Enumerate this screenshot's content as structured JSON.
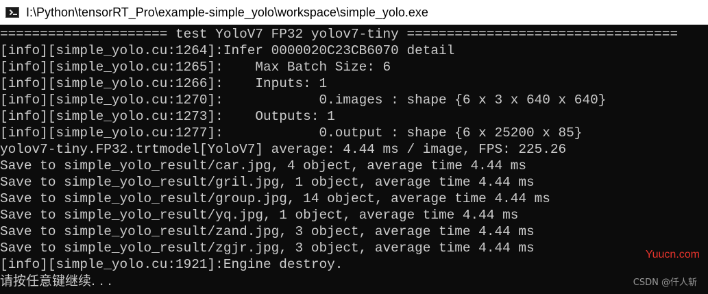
{
  "window": {
    "title": "I:\\Python\\tensorRT_Pro\\example-simple_yolo\\workspace\\simple_yolo.exe",
    "icon": "console-app-icon"
  },
  "console": {
    "lines": [
      "===================== test YoloV7 FP32 yolov7-tiny ==================================",
      "[info][simple_yolo.cu:1264]:Infer 0000020C23CB6070 detail",
      "[info][simple_yolo.cu:1265]:    Max Batch Size: 6",
      "[info][simple_yolo.cu:1266]:    Inputs: 1",
      "[info][simple_yolo.cu:1270]:            0.images : shape {6 x 3 x 640 x 640}",
      "[info][simple_yolo.cu:1273]:    Outputs: 1",
      "[info][simple_yolo.cu:1277]:            0.output : shape {6 x 25200 x 85}",
      "yolov7-tiny.FP32.trtmodel[YoloV7] average: 4.44 ms / image, FPS: 225.26",
      "Save to simple_yolo_result/car.jpg, 4 object, average time 4.44 ms",
      "Save to simple_yolo_result/gril.jpg, 1 object, average time 4.44 ms",
      "Save to simple_yolo_result/group.jpg, 14 object, average time 4.44 ms",
      "Save to simple_yolo_result/yq.jpg, 1 object, average time 4.44 ms",
      "Save to simple_yolo_result/zand.jpg, 3 object, average time 4.44 ms",
      "Save to simple_yolo_result/zgjr.jpg, 3 object, average time 4.44 ms",
      "[info][simple_yolo.cu:1921]:Engine destroy."
    ],
    "prompt": "请按任意键继续. . ."
  },
  "watermarks": {
    "site": "Yuucn.com",
    "csdn": "CSDN @仟人斩"
  },
  "colors": {
    "console_bg": "#0c0c0c",
    "console_text": "#cccccc",
    "titlebar_bg": "#ffffff",
    "site_watermark": "#e8342c"
  }
}
